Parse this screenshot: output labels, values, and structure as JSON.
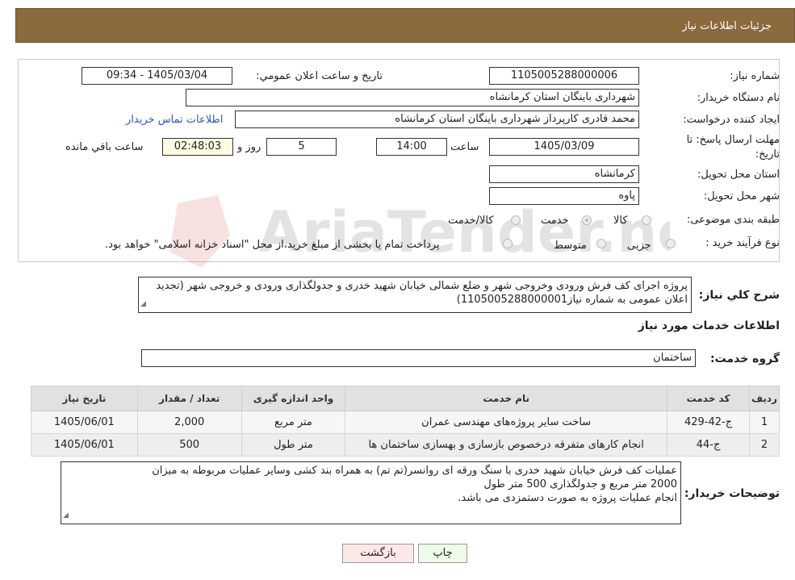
{
  "header": {
    "title": "جزئیات اطلاعات نیاز"
  },
  "form": {
    "need_number_label": "شماره نیاز:",
    "need_number": "1105005288000006",
    "announce_label": "تاریخ و ساعت اعلان عمومي:",
    "announce_value": "1405/03/04 - 09:34",
    "buyer_org_label": "نام دستگاه خریدار:",
    "buyer_org": "شهرداری باینگان استان کرمانشاه",
    "requester_label": "ایجاد کننده درخواست:",
    "requester": "محمد قادری کارپرداز شهرداری باینگان استان کرمانشاه",
    "contact_link": "اطلاعات تماس خریدار",
    "deadline_label_1": "مهلت ارسال پاسخ: تا",
    "deadline_label_2": "تاریخ:",
    "deadline_date": "1405/03/09",
    "time_label": "ساعت",
    "deadline_time": "14:00",
    "days_value": "5",
    "days_label": "روز و",
    "remaining_time": "02:48:03",
    "remaining_label": "ساعت باقي مانده",
    "province_label": "استان محل تحویل:",
    "province": "کرمانشاه",
    "city_label": "شهر محل تحویل:",
    "city": "پاوه",
    "category_label": "طبقه بندی موضوعی:",
    "category_options": [
      "کالا",
      "خدمت",
      "کالا/خدمت"
    ],
    "process_label": "نوع فرآیند خرید :",
    "process_options": [
      "جزیی",
      "متوسط"
    ],
    "process_note": "پرداخت تمام یا بخشی از مبلغ خرید،از محل \"اسناد خزانه اسلامی\" خواهد بود."
  },
  "summary": {
    "label": "شرح کلي نیاز:",
    "text": "پروژه اجرای کف فرش ورودی وخروجی شهر و ضلع شمالی خیابان شهید خدری و جدولگذاری ورودی و خروجی شهر (تجدید اعلان عمومی به شماره نیاز1105005288000001)"
  },
  "services_section": {
    "title": "اطلاعات خدمات مورد نیاز",
    "group_label": "گروه خدمت:",
    "group_value": "ساختمان"
  },
  "table": {
    "headers": [
      "ردیف",
      "کد خدمت",
      "نام خدمت",
      "واحد اندازه گیری",
      "تعداد / مقدار",
      "تاریخ نیاز"
    ],
    "rows": [
      [
        "1",
        "ج-42-429",
        "ساخت سایر پروژه‌های مهندسی عمران",
        "متر مربع",
        "2,000",
        "1405/06/01"
      ],
      [
        "2",
        "ج-44",
        "انجام کارهای متفرقه درخصوص بازسازی و بهسازی ساختمان ها",
        "متر طول",
        "500",
        "1405/06/01"
      ]
    ]
  },
  "buyer_notes": {
    "label": "توضیحات خریدار:",
    "lines": [
      "عملیات کف فرش خیابان شهید خدری با سنگ ورقه ای روانسر(تم تم) به همراه بند کشی  وسایر عملیات مربوطه به میزان",
      "2000 متر مربع و جدولگذاری 500 متر طول",
      "انجام عملیات پروژه به صورت دستمزدی می باشد."
    ]
  },
  "buttons": {
    "print": "چاپ",
    "back": "بازگشت"
  },
  "watermark": {
    "text": "AriaTender.neT"
  }
}
